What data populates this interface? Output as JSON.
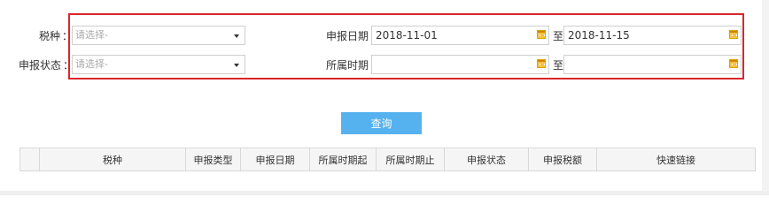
{
  "filters": {
    "tax_type_label": "税种",
    "colon": "：",
    "tax_type_placeholder": "请选择-",
    "report_status_label": "申报状态",
    "report_status_placeholder": "请选择-",
    "report_date_label": "申报日期",
    "report_date_from": "2018-11-01",
    "report_date_to": "2018-11-15",
    "period_label": "所属时期",
    "period_from": "",
    "period_to": "",
    "to_label": "至"
  },
  "query_button": "查询",
  "table": {
    "columns": [
      "",
      "税种",
      "申报类型",
      "申报日期",
      "所属时期起",
      "所属时期止",
      "申报状态",
      "申报税额",
      "快速链接"
    ]
  },
  "colors": {
    "highlight": "#d9262c",
    "button": "#56b2ef",
    "calendar_icon": "#f7c244"
  }
}
